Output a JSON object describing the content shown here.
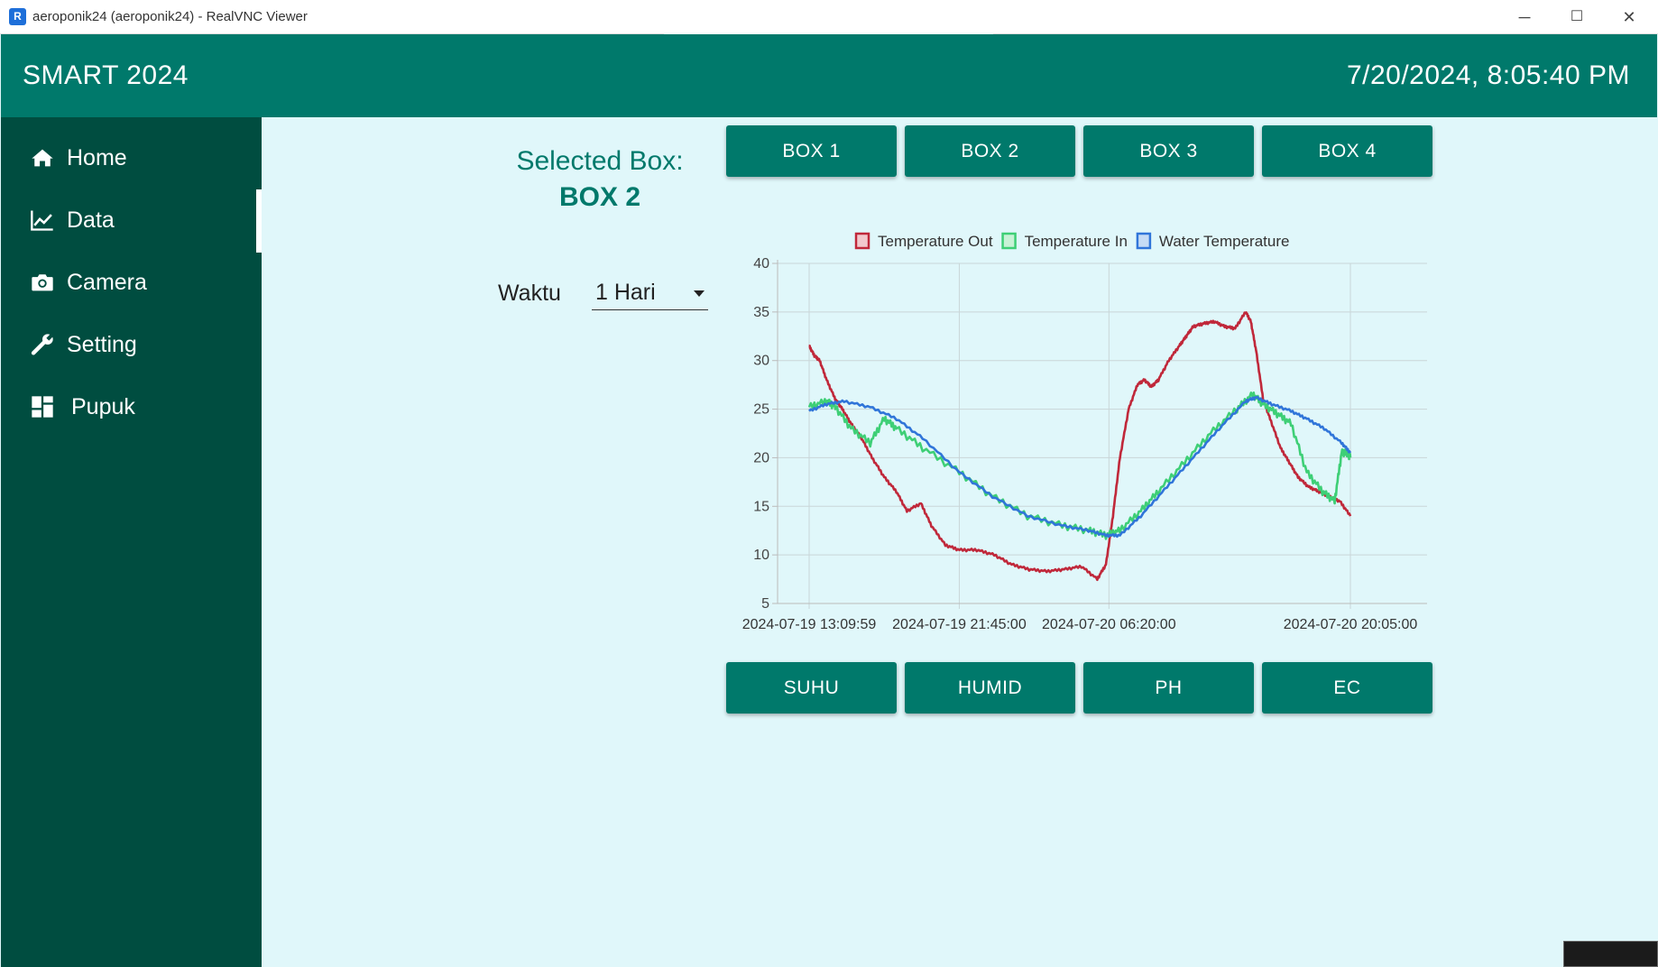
{
  "window": {
    "title": "aeroponik24 (aeroponik24) - RealVNC Viewer",
    "app_icon": "R",
    "minimize": "─",
    "maximize": "☐",
    "close": "✕"
  },
  "header": {
    "brand": "SMART 2024",
    "datetime": "7/20/2024, 8:05:40 PM"
  },
  "sidebar": {
    "items": [
      {
        "label": "Home",
        "icon": "home-icon"
      },
      {
        "label": "Data",
        "icon": "chart-line-icon",
        "active": true
      },
      {
        "label": "Camera",
        "icon": "camera-icon"
      },
      {
        "label": "Setting",
        "icon": "wrench-icon"
      },
      {
        "label": "Pupuk",
        "icon": "dashboard-icon"
      }
    ]
  },
  "selection": {
    "label": "Selected Box:",
    "value": "BOX 2"
  },
  "box_buttons": [
    "BOX 1",
    "BOX 2",
    "BOX 3",
    "BOX 4"
  ],
  "waktu": {
    "label": "Waktu",
    "selected": "1 Hari"
  },
  "metric_buttons": [
    "SUHU",
    "HUMID",
    "PH",
    "EC"
  ],
  "colors": {
    "header": "#00796b",
    "sidebar": "#004d40",
    "background": "#e0f7fa",
    "button": "#00796b"
  },
  "chart_data": {
    "type": "line",
    "ylim": [
      5,
      40
    ],
    "yticks": [
      5,
      10,
      15,
      20,
      25,
      30,
      35,
      40
    ],
    "xlabels": [
      "2024-07-19 13:09:59",
      "2024-07-19 21:45:00",
      "2024-07-20 06:20:00",
      "2024-07-20 20:05:00"
    ],
    "xtick_hours": [
      0,
      8.6,
      17.17,
      31
    ],
    "grid": true,
    "legend_position": "top",
    "series": [
      {
        "name": "Temperature Out",
        "color": "#c0283a",
        "fill": "#f2c9cd",
        "x": [
          0,
          0.3,
          0.6,
          1.0,
          1.5,
          1.9,
          2.4,
          3.0,
          3.6,
          4.3,
          5.0,
          5.6,
          6.4,
          7.0,
          7.8,
          8.6,
          9.6,
          10.6,
          11.6,
          12.6,
          13.6,
          14.6,
          15.6,
          16.5,
          17.0,
          17.4,
          17.8,
          18.3,
          18.8,
          19.2,
          19.6,
          20.0,
          20.6,
          21.2,
          21.6,
          22.0,
          22.6,
          23.2,
          23.8,
          24.4,
          25.0,
          25.3,
          25.6,
          26.0,
          26.4,
          27.0,
          27.5,
          28.0,
          28.6,
          29.2,
          29.8,
          30.4,
          31.0
        ],
        "y": [
          31.5,
          30.5,
          30,
          28,
          26,
          25,
          23.5,
          22,
          20,
          18,
          16.5,
          14.5,
          15.3,
          13,
          11,
          10.5,
          10.5,
          10,
          9,
          8.5,
          8.3,
          8.5,
          8.8,
          7.5,
          9,
          14,
          20,
          25,
          27.5,
          28,
          27.3,
          28,
          30,
          31.5,
          32.5,
          33.5,
          33.8,
          34,
          33.5,
          33.3,
          35,
          34,
          31,
          26,
          24,
          21,
          19.5,
          18,
          17,
          16.5,
          16,
          15.5,
          14
        ]
      },
      {
        "name": "Temperature In",
        "color": "#3ecf76",
        "fill": "#c8f2d6",
        "x": [
          0,
          1.0,
          1.5,
          2.4,
          3.5,
          4.3,
          5.0,
          6.5,
          8.6,
          10.5,
          12.5,
          14.5,
          16.0,
          17.0,
          17.8,
          19.0,
          20.0,
          21.5,
          23.0,
          24.5,
          25.4,
          26.0,
          26.8,
          27.6,
          28.5,
          29.4,
          30.1,
          30.5,
          30.8,
          31.0
        ],
        "y": [
          25.2,
          25.8,
          25.2,
          23,
          21.5,
          24,
          23,
          21,
          18.5,
          16,
          14,
          13,
          12.5,
          12,
          12.5,
          14.5,
          16.5,
          19.5,
          22.5,
          25,
          26.5,
          25.5,
          24.5,
          23.5,
          18.5,
          16.5,
          15.5,
          20.5,
          20.5,
          20
        ]
      },
      {
        "name": "Water Temperature",
        "color": "#3075d9",
        "fill": "#c6dcf5",
        "x": [
          0,
          1.0,
          2.0,
          3.5,
          5.0,
          6.5,
          8.6,
          10.5,
          12.5,
          14.5,
          16.0,
          17.0,
          17.8,
          19.0,
          20.5,
          22.0,
          23.5,
          25.0,
          25.6,
          26.5,
          27.6,
          28.5,
          29.5,
          30.5,
          31.0
        ],
        "y": [
          24.8,
          25.5,
          25.8,
          25.2,
          24,
          22,
          18.5,
          16,
          14,
          13,
          12.5,
          12,
          12,
          14,
          17,
          20,
          23,
          25.8,
          26.2,
          25.5,
          24.8,
          24,
          23,
          21.5,
          20.5
        ]
      }
    ]
  }
}
